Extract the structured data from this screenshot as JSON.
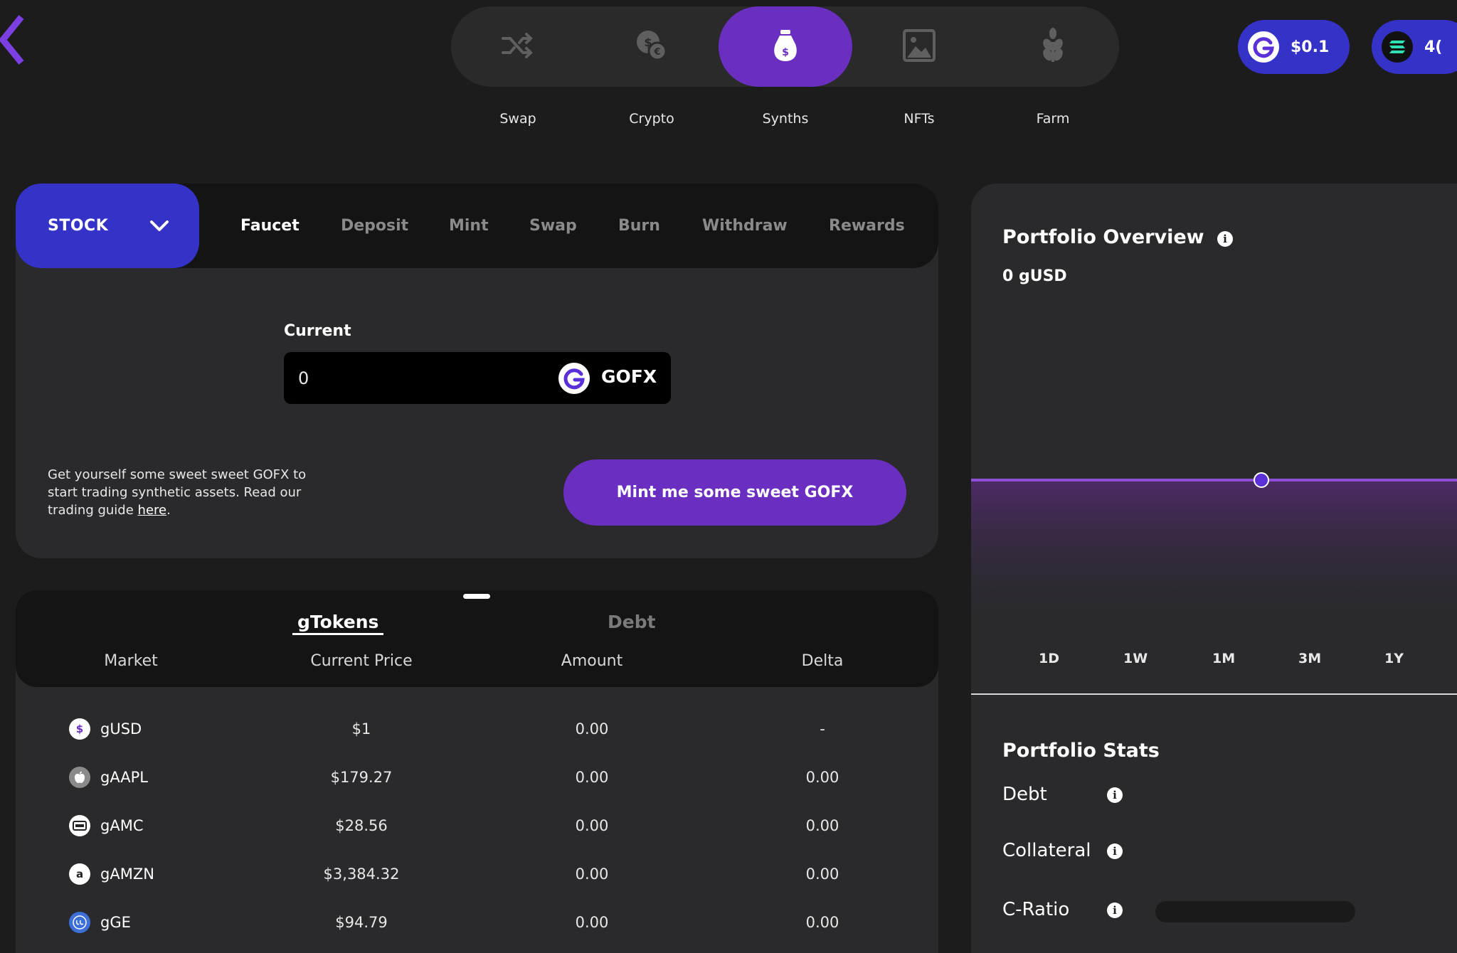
{
  "nav": {
    "items": [
      {
        "label": "Swap",
        "icon": "shuffle-icon"
      },
      {
        "label": "Crypto",
        "icon": "coins-icon"
      },
      {
        "label": "Synths",
        "icon": "money-bag-icon"
      },
      {
        "label": "NFTs",
        "icon": "image-icon"
      },
      {
        "label": "Farm",
        "icon": "plant-icon"
      }
    ],
    "active": "Synths"
  },
  "wallet": {
    "gofx_price": "$0.1",
    "sol_balance": "4("
  },
  "market_select": {
    "value": "STOCK"
  },
  "tabs": [
    "Faucet",
    "Deposit",
    "Mint",
    "Swap",
    "Burn",
    "Withdraw",
    "Rewards"
  ],
  "active_tab": "Faucet",
  "faucet": {
    "current_label": "Current",
    "current_value": "0",
    "token": "GOFX",
    "desc_prefix": "Get yourself some sweet sweet GOFX to start trading synthetic assets. Read our trading guide ",
    "desc_link": "here",
    "desc_suffix": ".",
    "mint_button": "Mint me some sweet GOFX"
  },
  "table": {
    "tabs": [
      "gTokens",
      "Debt"
    ],
    "active_tab": "gTokens",
    "columns": [
      "Market",
      "Current Price",
      "Amount",
      "Delta"
    ],
    "rows": [
      {
        "market": "gUSD",
        "icon": "dollar-icon",
        "price": "$1",
        "amount": "0.00",
        "delta": "-"
      },
      {
        "market": "gAAPL",
        "icon": "apple-icon",
        "price": "$179.27",
        "amount": "0.00",
        "delta": "0.00"
      },
      {
        "market": "gAMC",
        "icon": "amc-icon",
        "price": "$28.56",
        "amount": "0.00",
        "delta": "0.00"
      },
      {
        "market": "gAMZN",
        "icon": "amazon-icon",
        "price": "$3,384.32",
        "amount": "0.00",
        "delta": "0.00"
      },
      {
        "market": "gGE",
        "icon": "ge-icon",
        "price": "$94.79",
        "amount": "0.00",
        "delta": "0.00"
      }
    ]
  },
  "portfolio": {
    "title": "Portfolio Overview",
    "value": "0 gUSD",
    "ranges": [
      "1D",
      "1W",
      "1M",
      "3M",
      "1Y"
    ],
    "stats_title": "Portfolio Stats",
    "stats": [
      "Debt",
      "Collateral",
      "C-Ratio"
    ]
  },
  "colors": {
    "accent_purple": "#6a2fc0",
    "accent_blue": "#3532c7",
    "background": "#1c1c1c",
    "panel": "#2a2a2d"
  },
  "chart_data": {
    "type": "area",
    "x": [],
    "series": [
      {
        "values": [
          0
        ]
      }
    ],
    "title": "",
    "xlabel": "",
    "ylabel": ""
  }
}
